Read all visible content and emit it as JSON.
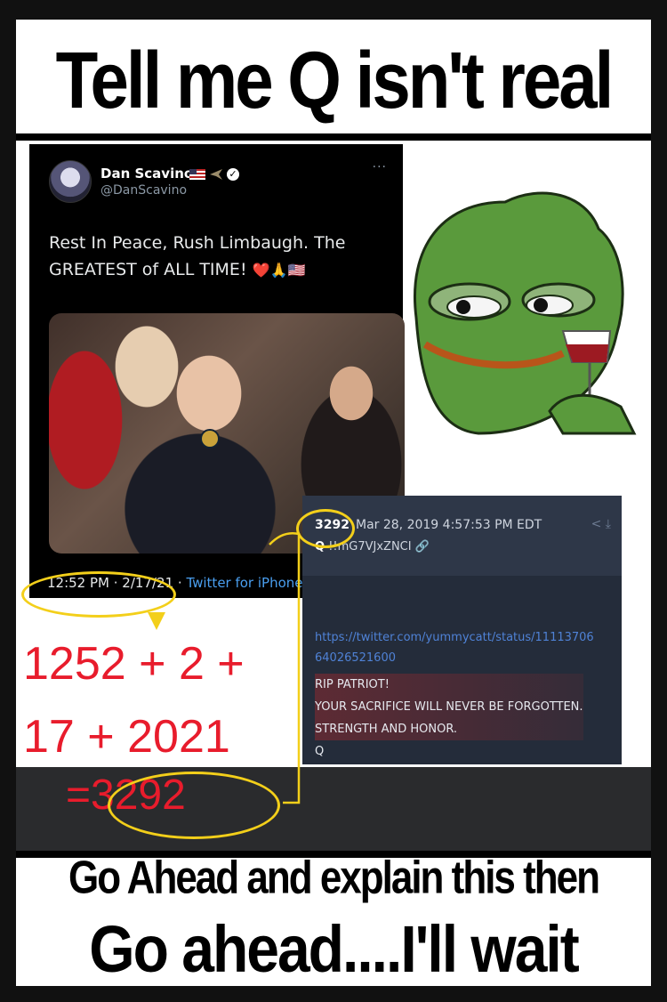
{
  "title": "Tell me Q isn't real",
  "tweet": {
    "name": "Dan Scavino",
    "handle": "@DanScavino",
    "text_line1": "Rest In Peace, Rush Limbaugh. The",
    "text_line2": "GREATEST of ALL TIME!",
    "emoji": "❤️🙏🇺🇸",
    "time": "12:52 PM · 2/17/21 ·",
    "source": "Twitter for iPhone",
    "more": "···"
  },
  "math": {
    "line1": "1252 + 2 +",
    "line2": "17 + 2021",
    "equals": "=",
    "result": "3292"
  },
  "qpost": {
    "number": "3292",
    "date": "Mar 28, 2019 4:57:53 PM EDT",
    "trip_prefix": "Q",
    "trip": "!!mG7VJxZNCI",
    "url": "https://twitter.com/yummycatt/status/1111370664026521600",
    "body": [
      "RIP PATRIOT!",
      "YOUR SACRIFICE WILL NEVER BE FORGOTTEN.",
      "STRENGTH AND HONOR.",
      "Q"
    ]
  },
  "bottom": {
    "line1": "Go Ahead and explain this then",
    "line2": "Go ahead....I'll wait"
  },
  "colors": {
    "highlight": "#f3cf1a",
    "math": "#e81c2c",
    "pepe_green": "#5a9a3c",
    "wine": "#9c1a22"
  }
}
